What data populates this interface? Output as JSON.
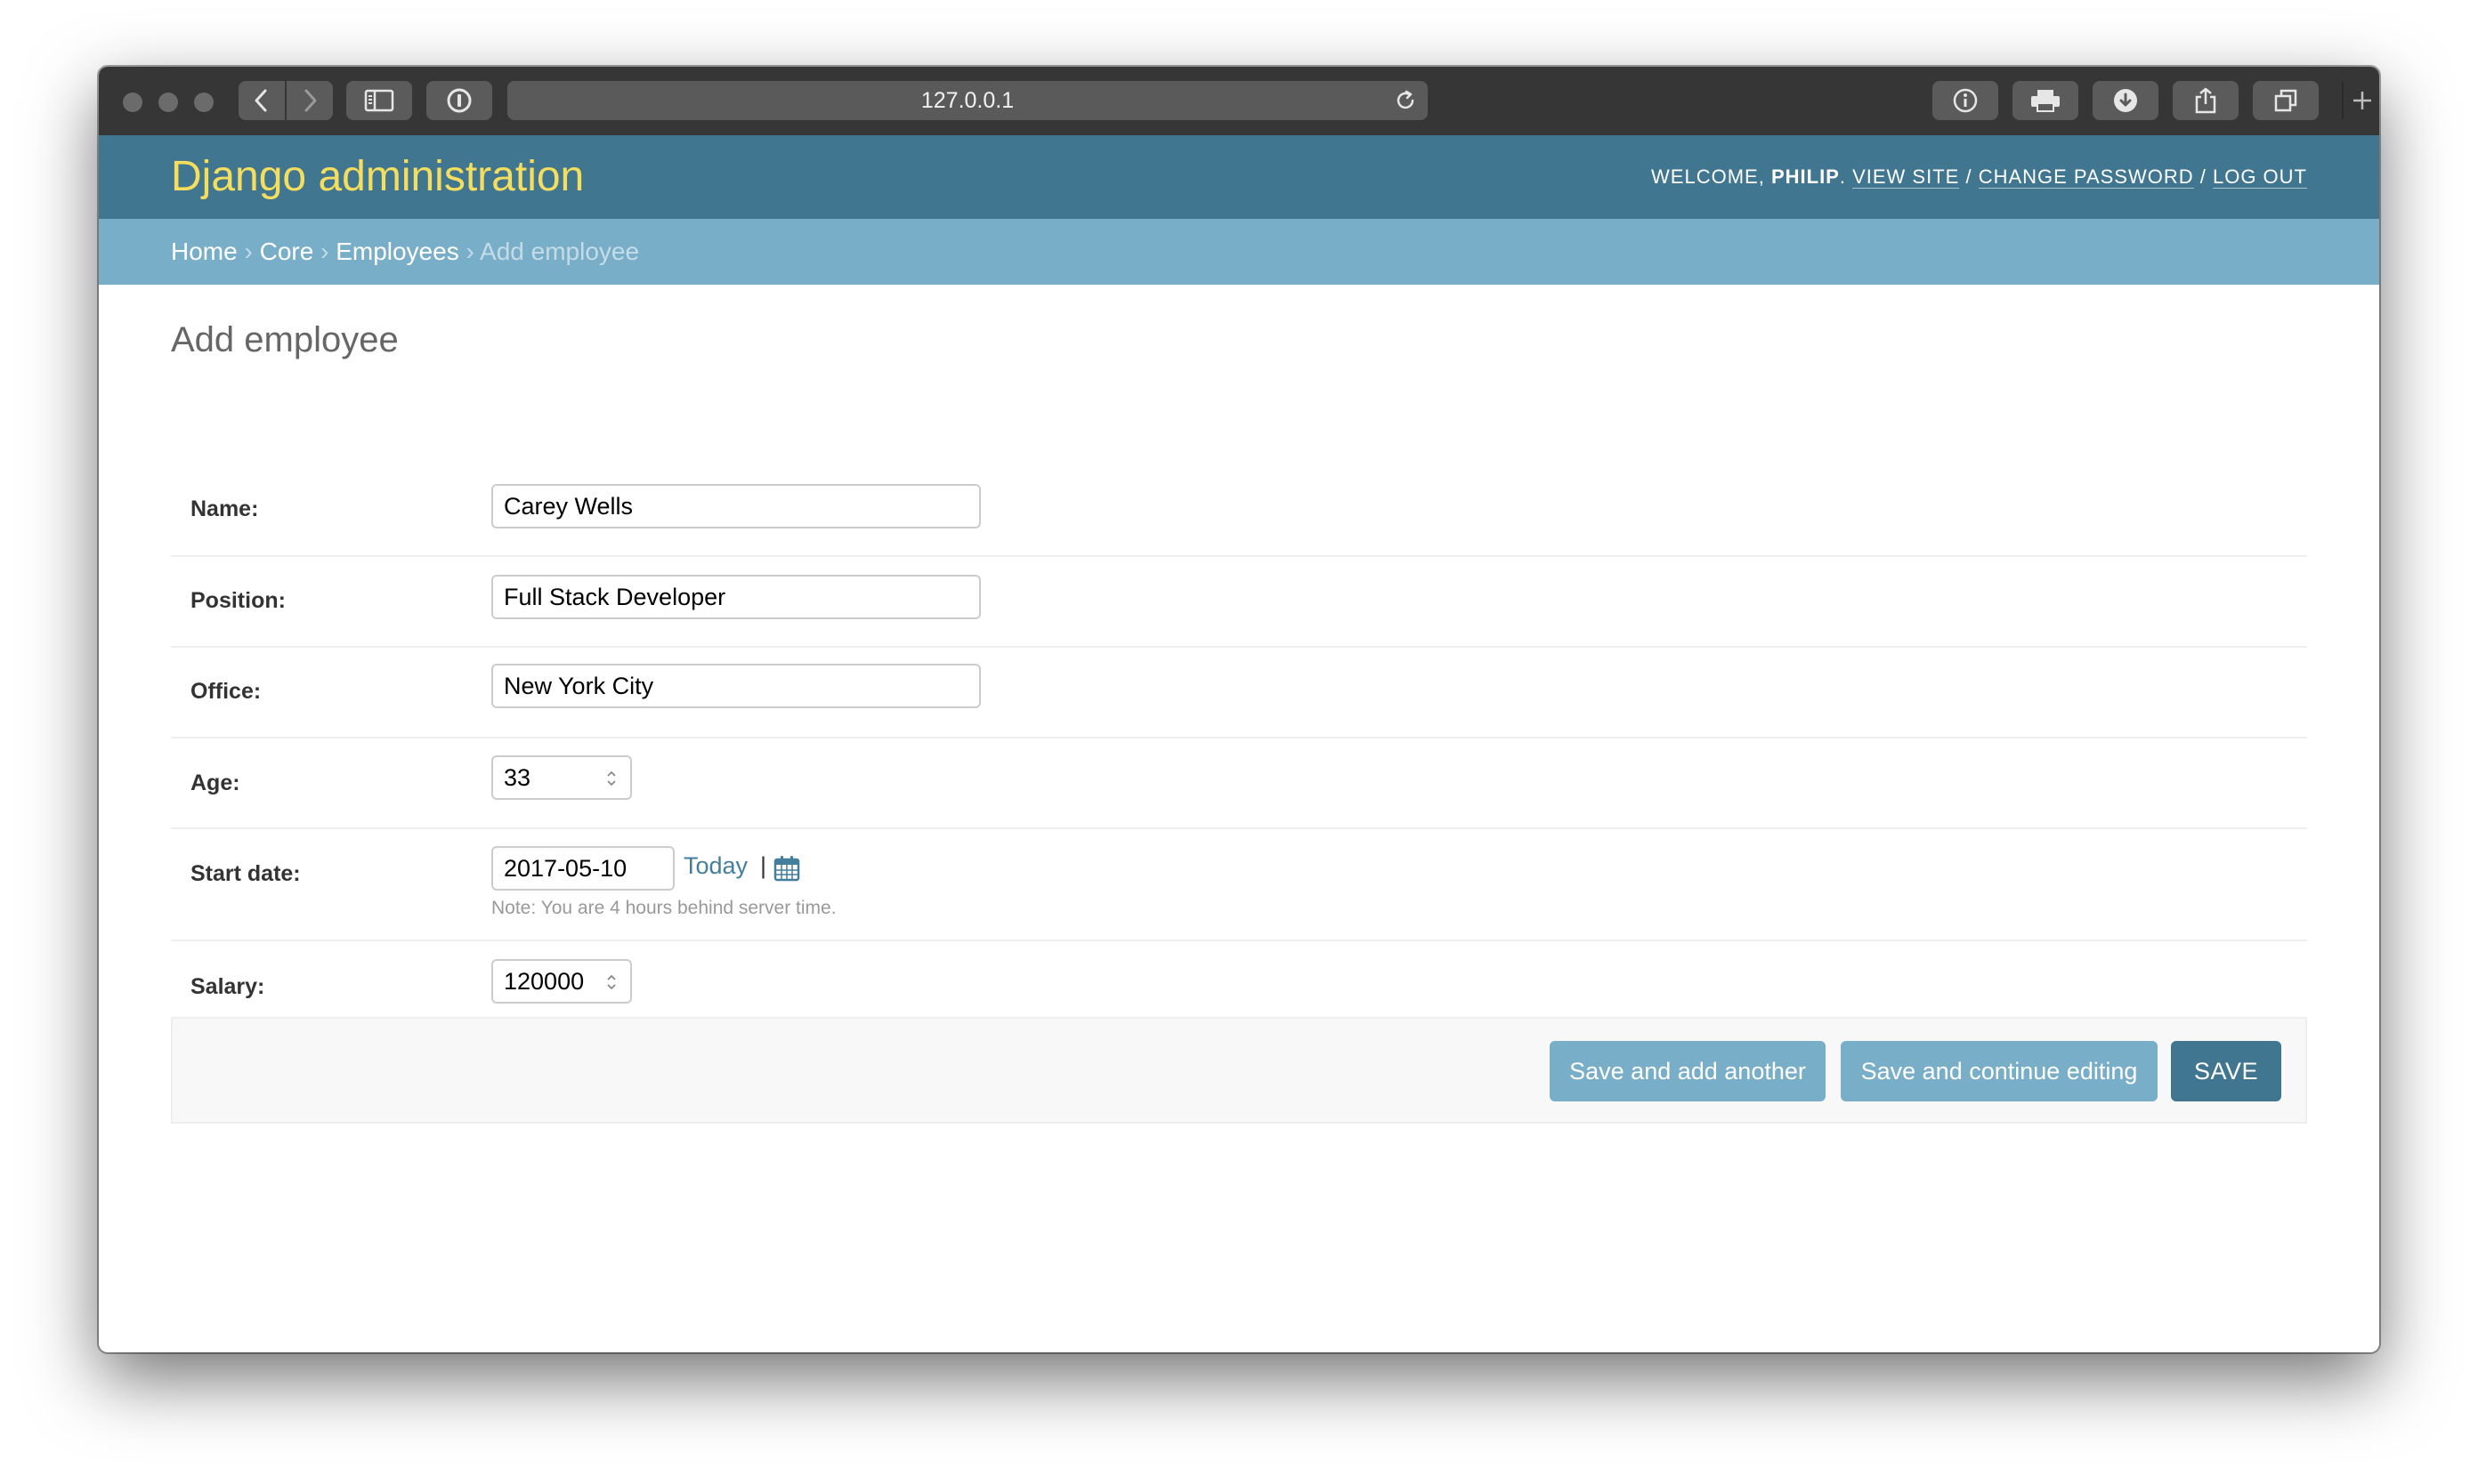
{
  "browser": {
    "url": "127.0.0.1",
    "back_icon": "chevron-left-icon",
    "forward_icon": "chevron-right-icon",
    "sidebar_icon": "sidebar-icon",
    "password_icon": "1password-icon",
    "reload_icon": "reload-icon",
    "toolbar_icons": [
      "info-icon",
      "print-icon",
      "download-icon",
      "share-icon",
      "tabs-icon",
      "plus-icon"
    ]
  },
  "header": {
    "brand": "Django administration",
    "welcome": "WELCOME, ",
    "username": "PHILIP",
    "after_user": ". ",
    "view_site": "VIEW SITE",
    "sep": " / ",
    "change_password": "CHANGE PASSWORD",
    "log_out": "LOG OUT"
  },
  "breadcrumbs": {
    "home": "Home",
    "core": "Core",
    "employees": "Employees",
    "current": "Add employee",
    "separator": "›"
  },
  "page_title": "Add employee",
  "form": {
    "name": {
      "label": "Name:",
      "value": "Carey Wells"
    },
    "position": {
      "label": "Position:",
      "value": "Full Stack Developer"
    },
    "office": {
      "label": "Office:",
      "value": "New York City"
    },
    "age": {
      "label": "Age:",
      "value": "33"
    },
    "start_date": {
      "label": "Start date:",
      "value": "2017-05-10",
      "today_link": "Today",
      "divider": "|",
      "calendar_icon": "calendar-icon",
      "note": "Note: You are 4 hours behind server time."
    },
    "salary": {
      "label": "Salary:",
      "value": "120000"
    }
  },
  "buttons": {
    "save_add_another": "Save and add another",
    "save_continue": "Save and continue editing",
    "save": "SAVE"
  },
  "colors": {
    "header": "#417690",
    "brand": "#f5dd5d",
    "breadcrumbs": "#79aec8",
    "primary_button": "#417690",
    "secondary_button": "#79aec8"
  }
}
